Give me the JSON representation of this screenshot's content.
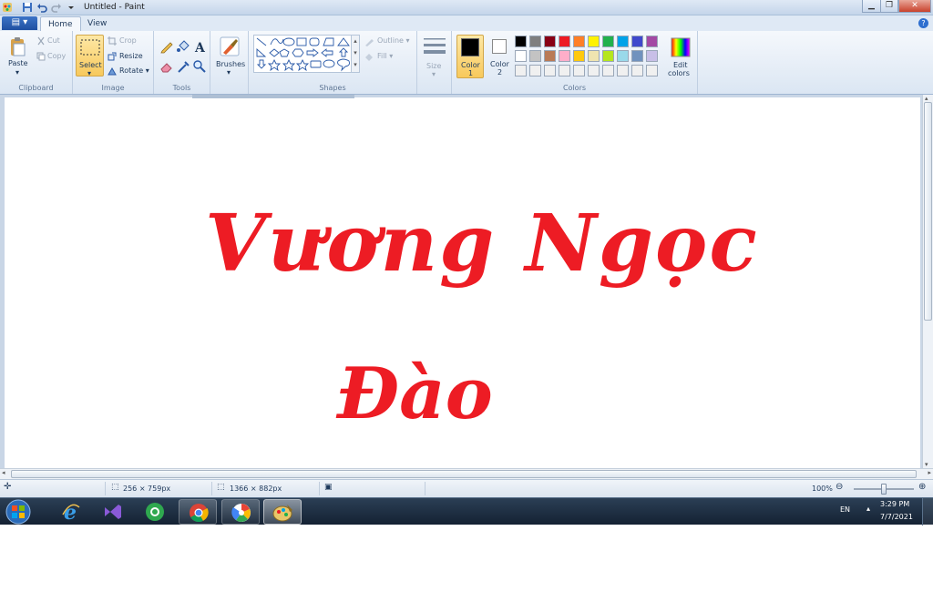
{
  "window": {
    "title": "Untitled - Paint",
    "controls": [
      "minimize",
      "maximize",
      "close"
    ]
  },
  "menu": {
    "file_icon": "paint-menu-icon",
    "tabs": [
      {
        "label": "Home",
        "active": true
      },
      {
        "label": "View",
        "active": false
      }
    ],
    "help_symbol": "?"
  },
  "ribbon": {
    "clipboard": {
      "group_label": "Clipboard",
      "paste_label": "Paste",
      "cut_label": "Cut",
      "copy_label": "Copy"
    },
    "image": {
      "group_label": "Image",
      "select_label": "Select",
      "crop_label": "Crop",
      "resize_label": "Resize",
      "rotate_label": "Rotate"
    },
    "tools": {
      "group_label": "Tools",
      "items": [
        "pencil-icon",
        "fill-icon",
        "text-icon",
        "eraser-icon",
        "color-picker-icon",
        "magnifier-icon"
      ],
      "text_tool_glyph": "A"
    },
    "brushes": {
      "label": "Brushes"
    },
    "shapes": {
      "group_label": "Shapes",
      "outline_label": "Outline",
      "fill_label": "Fill"
    },
    "size": {
      "label": "Size"
    },
    "colors": {
      "group_label": "Colors",
      "color1_label": "Color",
      "color1_number": "1",
      "color1_value": "#000000",
      "color2_label": "Color",
      "color2_number": "2",
      "color2_value": "#ffffff",
      "edit_label": "Edit",
      "edit_label2": "colors",
      "palette_row1": [
        "#000000",
        "#7f7f7f",
        "#880015",
        "#ed1c24",
        "#ff7f27",
        "#fff200",
        "#22b14c",
        "#00a2e8",
        "#3f48cc",
        "#a349a4"
      ],
      "palette_row2": [
        "#ffffff",
        "#c3c3c3",
        "#b97a57",
        "#ffaec9",
        "#ffc90e",
        "#efe4b0",
        "#b5e61d",
        "#99d9ea",
        "#7092be",
        "#c8bfe7"
      ],
      "palette_row3": [
        "#f0f0f0",
        "#f0f0f0",
        "#f0f0f0",
        "#f0f0f0",
        "#f0f0f0",
        "#f0f0f0",
        "#f0f0f0",
        "#f0f0f0",
        "#f0f0f0",
        "#f0f0f0"
      ]
    }
  },
  "canvas": {
    "ink_color": "#ed1c24",
    "lines": [
      "Vương Ngọc",
      "Đào"
    ]
  },
  "status": {
    "selection_size": "256 × 759px",
    "image_size": "1366 × 882px",
    "zoom": "100%",
    "zoom_level": 0.5
  },
  "taskbar": {
    "items": [
      {
        "name": "start-button",
        "state": "normal"
      },
      {
        "name": "internet-explorer-icon",
        "state": "normal"
      },
      {
        "name": "visual-studio-icon",
        "state": "normal"
      },
      {
        "name": "coccoc-browser-icon",
        "state": "normal"
      },
      {
        "name": "chrome-icon",
        "state": "open"
      },
      {
        "name": "picasa-icon",
        "state": "open"
      },
      {
        "name": "paint-icon",
        "state": "active"
      }
    ],
    "language": "EN",
    "time": "3:29 PM",
    "date": "7/7/2021"
  }
}
